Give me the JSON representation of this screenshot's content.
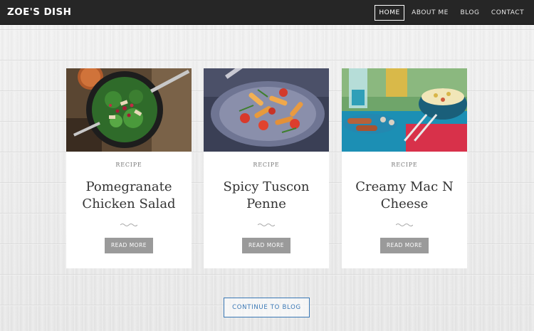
{
  "brand": {
    "name": "ZOE'S DISH"
  },
  "nav": {
    "items": [
      {
        "label": "HOME",
        "active": true
      },
      {
        "label": "ABOUT ME",
        "active": false
      },
      {
        "label": "BLOG",
        "active": false
      },
      {
        "label": "CONTACT",
        "active": false
      }
    ]
  },
  "cards": [
    {
      "category": "RECIPE",
      "title": "Pomegranate Chicken Salad",
      "button": "READ MORE",
      "image": "salad-photo"
    },
    {
      "category": "RECIPE",
      "title": "Spicy Tuscon Penne",
      "button": "READ MORE",
      "image": "penne-photo"
    },
    {
      "category": "RECIPE",
      "title": "Creamy Mac N Cheese",
      "button": "READ MORE",
      "image": "mac-n-cheese-photo"
    }
  ],
  "continue_button": {
    "label": "CONTINUE TO BLOG"
  },
  "colors": {
    "navbar": "#262626",
    "accent": "#3a78b5",
    "button_gray": "#9a9a9a"
  }
}
